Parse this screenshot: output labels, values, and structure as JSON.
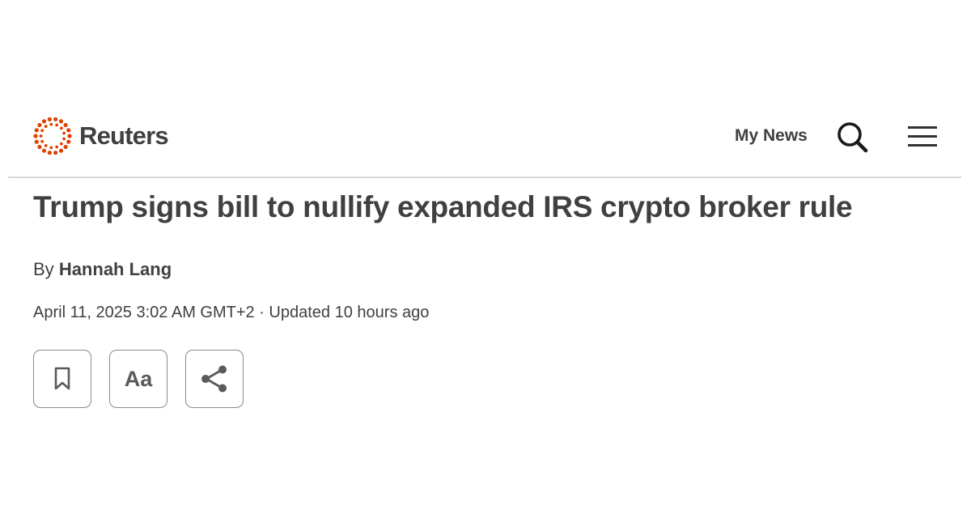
{
  "header": {
    "logo_text": "Reuters",
    "my_news_label": "My News",
    "search_icon": "search-icon",
    "menu_icon": "hamburger-menu-icon",
    "brand_color": "#dc4300"
  },
  "article": {
    "headline": "Trump signs bill to nullify expanded IRS crypto broker rule",
    "byline_prefix": "By",
    "author": "Hannah Lang",
    "dateline": "April 11, 2025 3:02 AM GMT+2 · Updated 10 hours ago"
  },
  "actions": {
    "bookmark_icon": "bookmark-icon",
    "text_size_label": "Aa",
    "share_icon": "share-icon"
  }
}
